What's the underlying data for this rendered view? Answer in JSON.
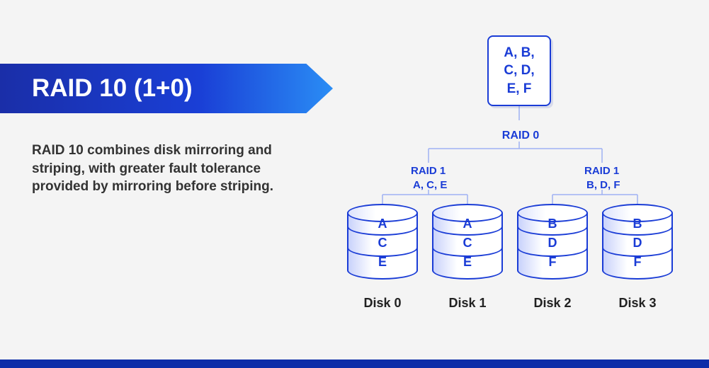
{
  "title": "RAID 10 (1+0)",
  "description": "RAID 10 combines disk mirroring and striping, with greater fault tolerance provided by mirroring before striping.",
  "top_box": {
    "line1": "A, B,",
    "line2": "C, D,",
    "line3": "E, F"
  },
  "labels": {
    "raid0": "RAID 0",
    "raid1_left": "RAID 1",
    "raid1_right": "RAID 1",
    "group_left": "A, C, E",
    "group_right": "B, D, F"
  },
  "disks": [
    {
      "name": "Disk 0",
      "blocks": [
        "A",
        "C",
        "E"
      ]
    },
    {
      "name": "Disk 1",
      "blocks": [
        "A",
        "C",
        "E"
      ]
    },
    {
      "name": "Disk 2",
      "blocks": [
        "B",
        "D",
        "F"
      ]
    },
    {
      "name": "Disk 3",
      "blocks": [
        "B",
        "D",
        "F"
      ]
    }
  ],
  "colors": {
    "accent": "#1a3cd6",
    "banner_start": "#1a2ea8",
    "banner_end": "#2a8df5",
    "footer": "#0d2da8"
  }
}
